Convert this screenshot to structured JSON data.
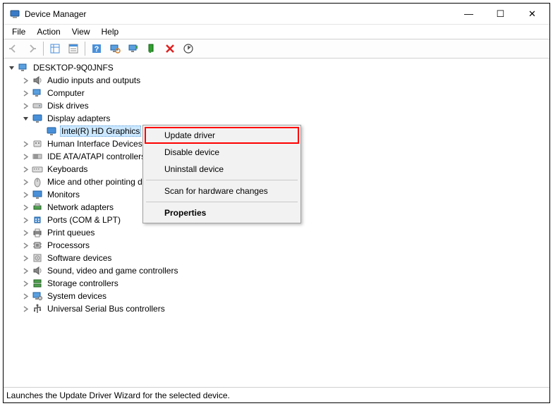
{
  "title": "Device Manager",
  "window_controls": {
    "min": "—",
    "max": "☐",
    "close": "✕"
  },
  "menus": [
    "File",
    "Action",
    "View",
    "Help"
  ],
  "root": "DESKTOP-9Q0JNFS",
  "categories": [
    {
      "label": "Audio inputs and outputs",
      "icon": "audio"
    },
    {
      "label": "Computer",
      "icon": "computer"
    },
    {
      "label": "Disk drives",
      "icon": "disk"
    },
    {
      "label": "Display adapters",
      "icon": "display",
      "expanded": true,
      "children": [
        {
          "label": "Intel(R) HD Graphics",
          "icon": "display"
        }
      ]
    },
    {
      "label": "Human Interface Devices",
      "icon": "hid"
    },
    {
      "label": "IDE ATA/ATAPI controllers",
      "icon": "ide"
    },
    {
      "label": "Keyboards",
      "icon": "keyboard"
    },
    {
      "label": "Mice and other pointing devices",
      "icon": "mouse"
    },
    {
      "label": "Monitors",
      "icon": "monitor"
    },
    {
      "label": "Network adapters",
      "icon": "network"
    },
    {
      "label": "Ports (COM & LPT)",
      "icon": "port"
    },
    {
      "label": "Print queues",
      "icon": "printer"
    },
    {
      "label": "Processors",
      "icon": "cpu"
    },
    {
      "label": "Software devices",
      "icon": "software"
    },
    {
      "label": "Sound, video and game controllers",
      "icon": "audio"
    },
    {
      "label": "Storage controllers",
      "icon": "storage"
    },
    {
      "label": "System devices",
      "icon": "system"
    },
    {
      "label": "Universal Serial Bus controllers",
      "icon": "usb"
    }
  ],
  "context_menu": {
    "items": [
      {
        "label": "Update driver",
        "highlight": true
      },
      {
        "label": "Disable device"
      },
      {
        "label": "Uninstall device"
      },
      {
        "sep": true
      },
      {
        "label": "Scan for hardware changes"
      },
      {
        "sep": true
      },
      {
        "label": "Properties",
        "bold": true
      }
    ]
  },
  "statusbar": "Launches the Update Driver Wizard for the selected device."
}
